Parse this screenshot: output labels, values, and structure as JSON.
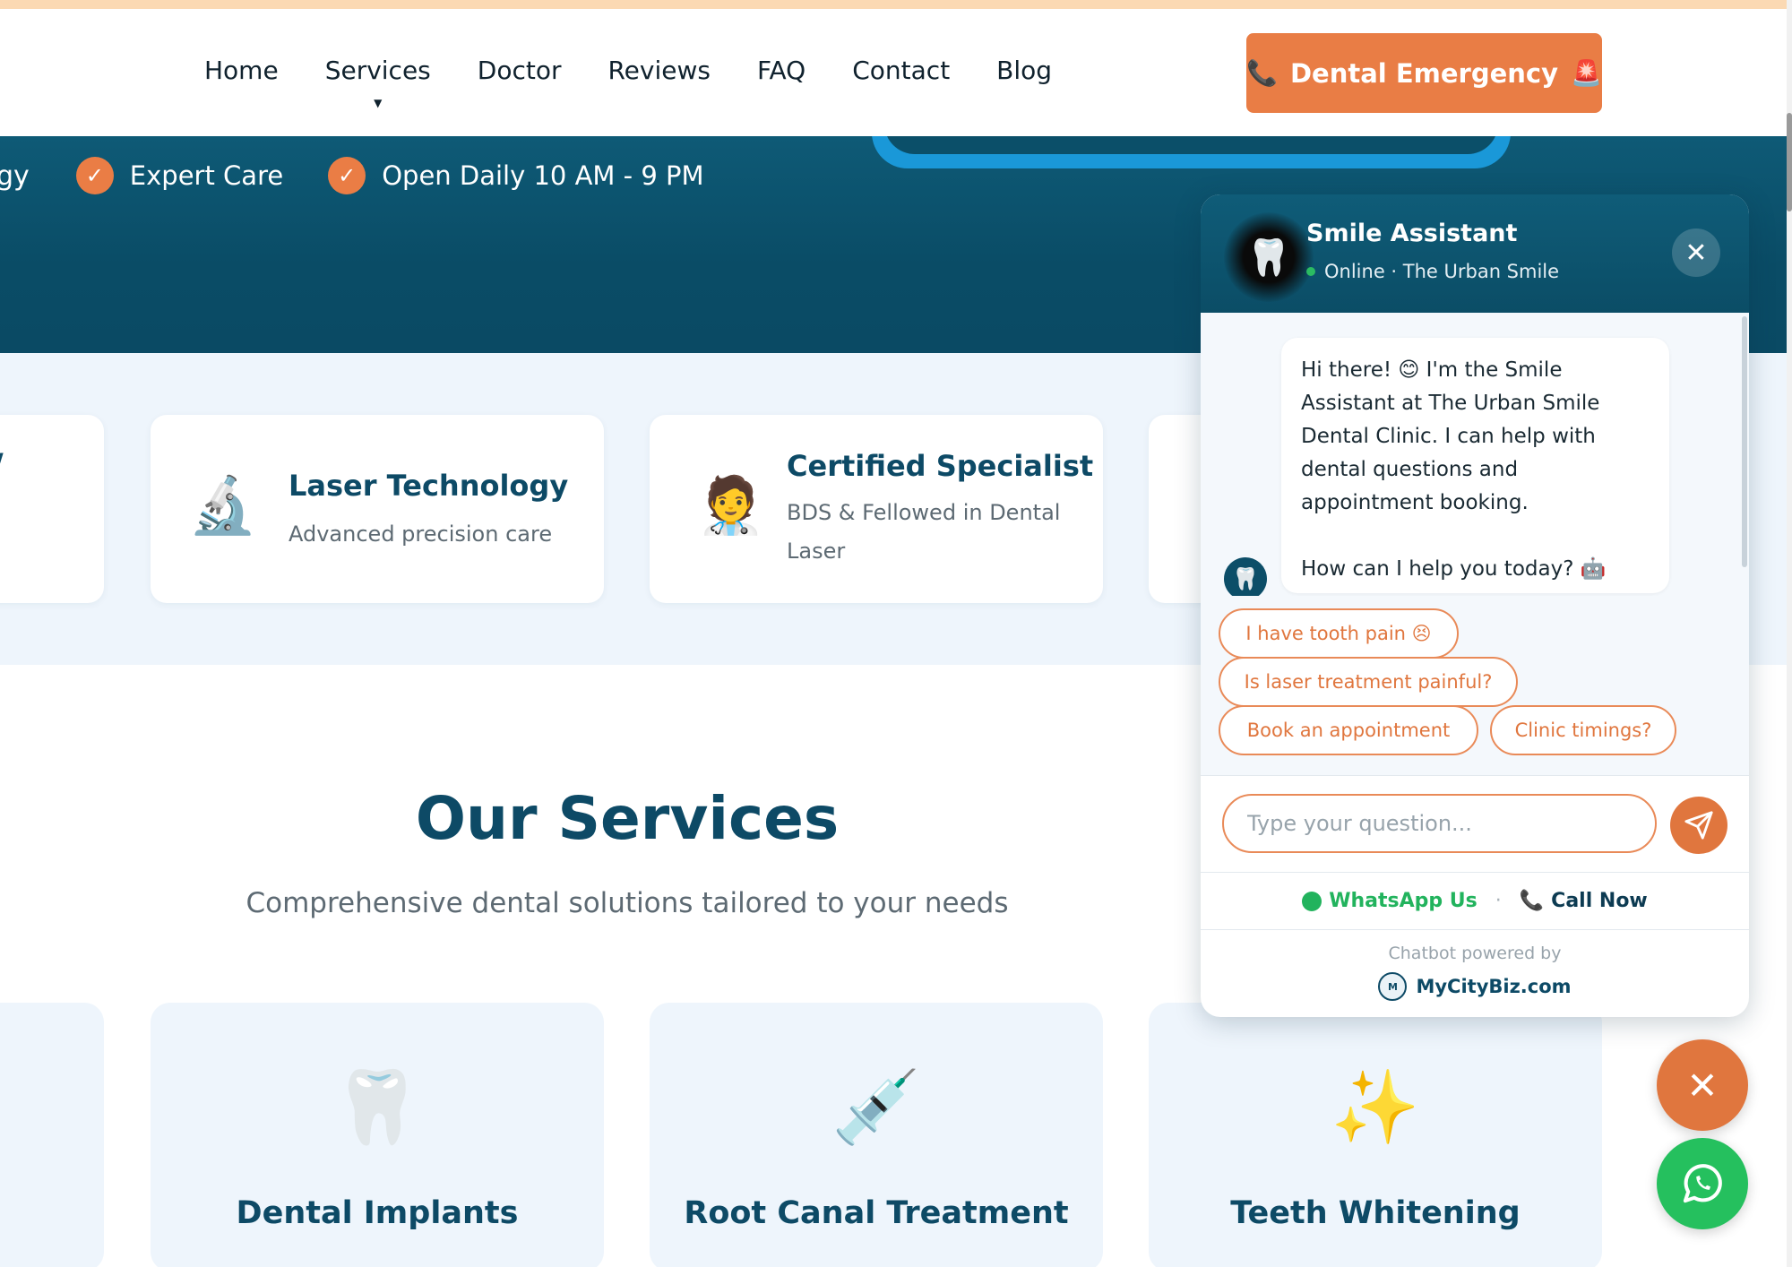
{
  "nav": {
    "items": [
      "Home",
      "Services",
      "Doctor",
      "Reviews",
      "FAQ",
      "Contact",
      "Blog"
    ],
    "emergency_label": "Dental Emergency"
  },
  "hero": {
    "badge_cut": "gy",
    "badges": [
      "Expert Care",
      "Open Daily 10 AM - 9 PM"
    ],
    "check_glyph": "✓"
  },
  "features": [
    {
      "title": "Laser Technology",
      "desc": "Advanced precision care",
      "icon": "microscope-icon"
    },
    {
      "title": "Certified Specialist",
      "desc": "BDS & Fellowed in Dental Laser",
      "icon": "doctor-icon"
    }
  ],
  "services": {
    "title": "Our Services",
    "subtitle": "Comprehensive dental solutions tailored to your needs",
    "cards": [
      {
        "title": "Dental Implants",
        "icon": "tooth-icon"
      },
      {
        "title": "Root Canal Treatment",
        "icon": "syringe-icon"
      },
      {
        "title": "Teeth Whitening",
        "icon": "sparkles-icon"
      }
    ]
  },
  "chat": {
    "title": "Smile Assistant",
    "status": "Online · The Urban Smile",
    "message_1": "Hi there! 😊 I'm the Smile Assistant at The Urban Smile Dental Clinic. I can help with dental questions and appointment booking.",
    "message_2": "How can I help you today? 🤖",
    "quick_replies": [
      "I have tooth pain 😣",
      "Is laser treatment painful?",
      "Book an appointment",
      "Clinic timings?"
    ],
    "input_placeholder": "Type your question...",
    "whatsapp_label": "WhatsApp Us",
    "separator": "·",
    "call_label": "Call Now",
    "powered_by": "Chatbot powered by",
    "brand": "MyCityBiz.com"
  },
  "colors": {
    "accent": "#e97d45",
    "primary": "#0d4a66",
    "whatsapp": "#25c05e"
  }
}
